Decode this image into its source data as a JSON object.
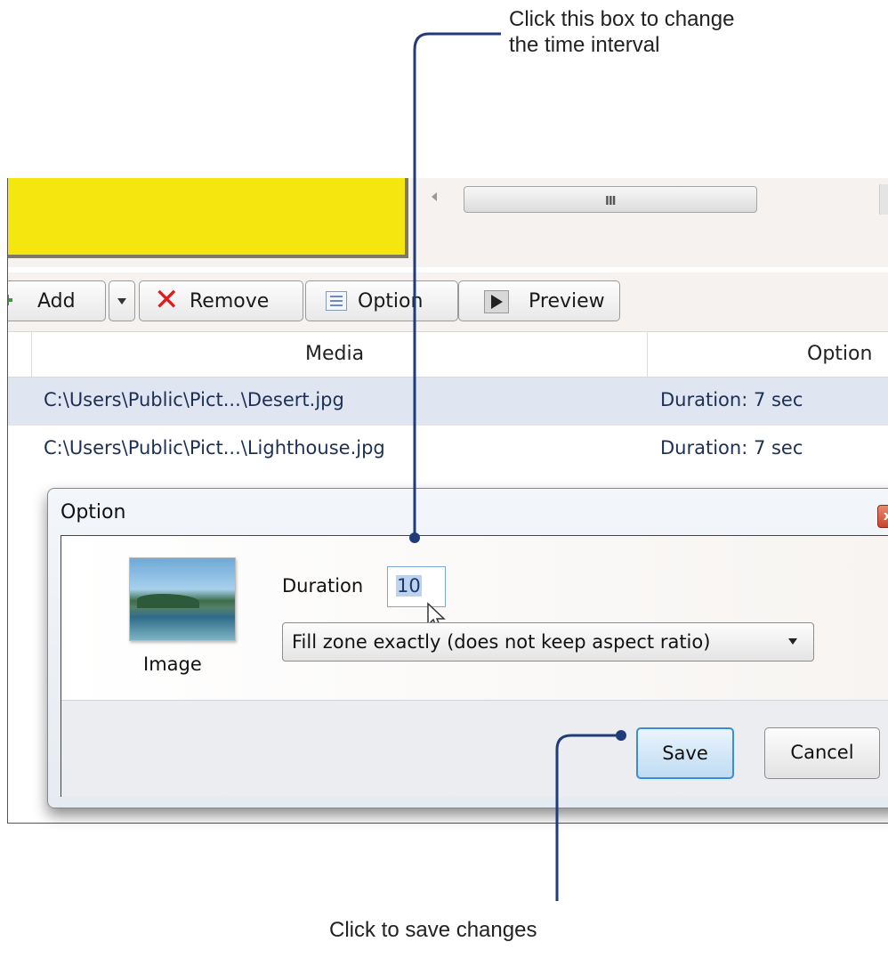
{
  "annotations": {
    "top_line1": "Click this box to change",
    "top_line2": "the time interval",
    "bottom": "Click to save changes"
  },
  "toolbar": {
    "add_label": "Add",
    "remove_label": "Remove",
    "option_label": "Option",
    "preview_label": "Preview"
  },
  "list": {
    "columns": {
      "media": "Media",
      "option": "Option"
    },
    "rows": [
      {
        "media": "C:\\Users\\Public\\Pict...\\Desert.jpg",
        "option": "Duration: 7 sec"
      },
      {
        "media": "C:\\Users\\Public\\Pict...\\Lighthouse.jpg",
        "option": "Duration: 7 sec"
      }
    ]
  },
  "dialog": {
    "title": "Option",
    "close_label": "x",
    "image_label": "Image",
    "duration_label": "Duration",
    "duration_value": "10",
    "fill_mode": "Fill zone exactly (does not keep aspect ratio)",
    "save_label": "Save",
    "cancel_label": "Cancel"
  },
  "colors": {
    "accent": "#1f3b7a",
    "zone": "#f5e60f"
  }
}
